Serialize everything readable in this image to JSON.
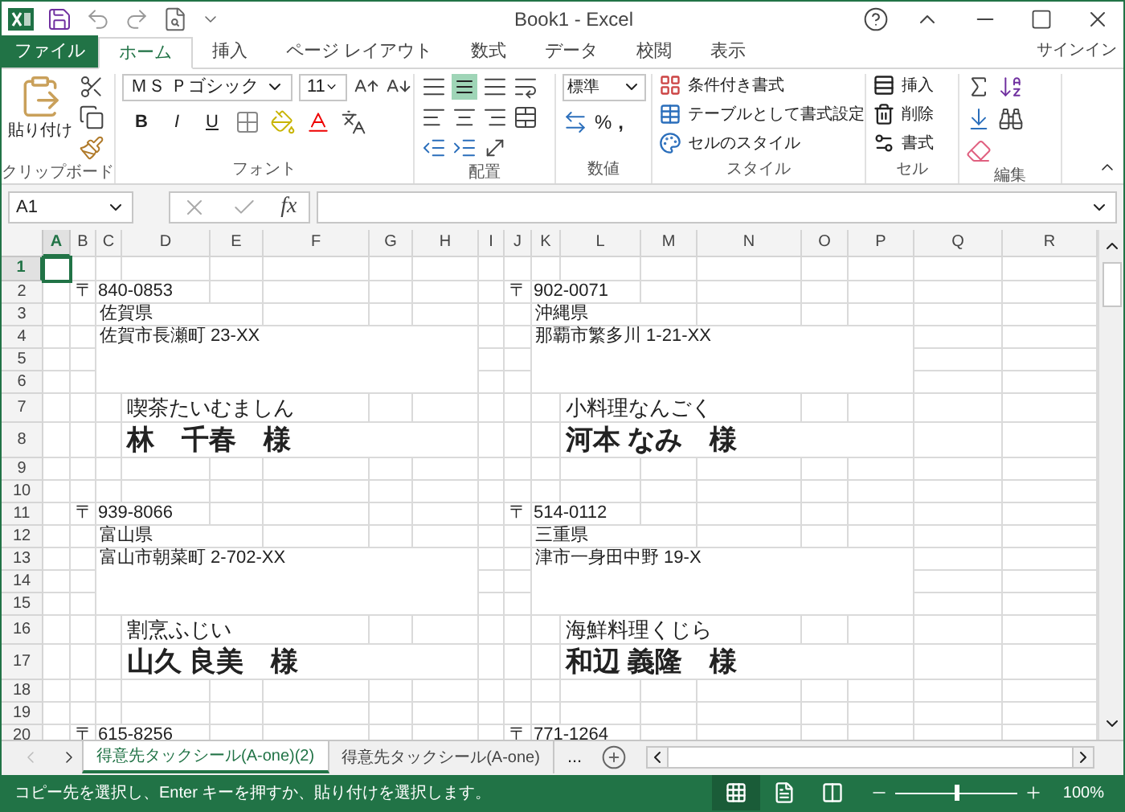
{
  "window": {
    "title": "Book1 - Excel"
  },
  "ribbon_tabs": [
    {
      "label": "ファイル",
      "kind": "file",
      "selected": false
    },
    {
      "label": "ホーム",
      "kind": "tab",
      "selected": true
    },
    {
      "label": "挿入",
      "kind": "tab",
      "selected": false
    },
    {
      "label": "ページ レイアウト",
      "kind": "tab",
      "selected": false
    },
    {
      "label": "数式",
      "kind": "tab",
      "selected": false
    },
    {
      "label": "データ",
      "kind": "tab",
      "selected": false
    },
    {
      "label": "校閲",
      "kind": "tab",
      "selected": false
    },
    {
      "label": "表示",
      "kind": "tab",
      "selected": false
    }
  ],
  "sign_in": "サインイン",
  "ribbon": {
    "clipboard": {
      "paste": "貼り付け",
      "label": "クリップボード"
    },
    "font": {
      "name": "ＭＳ Ｐゴシック",
      "size": "11",
      "format_buttons": [
        "B",
        "I",
        "U"
      ],
      "label": "フォント"
    },
    "alignment": {
      "label": "配置"
    },
    "number": {
      "format": "標準",
      "percent": "%",
      "comma": ",",
      "label": "数値"
    },
    "styles": {
      "items": [
        "条件付き書式",
        "テーブルとして書式設定",
        "セルのスタイル"
      ],
      "label": "スタイル"
    },
    "cells": {
      "items": [
        "挿入",
        "削除",
        "書式"
      ],
      "label": "セル"
    },
    "editing": {
      "label": "編集"
    }
  },
  "formula_bar": {
    "name_box": "A1",
    "function_label": "fx"
  },
  "columns": [
    {
      "label": "A",
      "selected": true
    },
    {
      "label": "B",
      "selected": false
    },
    {
      "label": "C",
      "selected": false
    },
    {
      "label": "D",
      "selected": false
    },
    {
      "label": "E",
      "selected": false
    },
    {
      "label": "F",
      "selected": false
    },
    {
      "label": "G",
      "selected": false
    },
    {
      "label": "H",
      "selected": false
    },
    {
      "label": "I",
      "selected": false
    },
    {
      "label": "J",
      "selected": false
    },
    {
      "label": "K",
      "selected": false
    },
    {
      "label": "L",
      "selected": false
    },
    {
      "label": "M",
      "selected": false
    },
    {
      "label": "N",
      "selected": false
    },
    {
      "label": "O",
      "selected": false
    },
    {
      "label": "P",
      "selected": false
    },
    {
      "label": "Q",
      "selected": false
    },
    {
      "label": "R",
      "selected": false
    }
  ],
  "rows": [
    {
      "label": "1",
      "selected": true
    },
    {
      "label": "2",
      "selected": false
    },
    {
      "label": "3",
      "selected": false
    },
    {
      "label": "4",
      "selected": false
    },
    {
      "label": "5",
      "selected": false
    },
    {
      "label": "6",
      "selected": false
    },
    {
      "label": "7",
      "selected": false
    },
    {
      "label": "8",
      "selected": false
    },
    {
      "label": "9",
      "selected": false
    },
    {
      "label": "10",
      "selected": false
    },
    {
      "label": "11",
      "selected": false
    },
    {
      "label": "12",
      "selected": false
    },
    {
      "label": "13",
      "selected": false
    },
    {
      "label": "14",
      "selected": false
    },
    {
      "label": "15",
      "selected": false
    },
    {
      "label": "16",
      "selected": false
    },
    {
      "label": "17",
      "selected": false
    },
    {
      "label": "18",
      "selected": false
    },
    {
      "label": "19",
      "selected": false
    },
    {
      "label": "20",
      "selected": false
    }
  ],
  "labels": [
    {
      "postal_mark": "〒",
      "postal": "840-0853",
      "prefecture": "佐賀県",
      "address": "佐賀市長瀬町 23-XX",
      "company": "喫茶たいむましん",
      "name": "林　千春　様"
    },
    {
      "postal_mark": "〒",
      "postal": "902-0071",
      "prefecture": "沖縄県",
      "address": "那覇市繁多川 1-21-XX",
      "company": "小料理なんごく",
      "name": "河本 なみ　様"
    },
    {
      "postal_mark": "〒",
      "postal": "939-8066",
      "prefecture": "富山県",
      "address": "富山市朝菜町 2-702-XX",
      "company": "割烹ふじい",
      "name": "山久 良美　様"
    },
    {
      "postal_mark": "〒",
      "postal": "514-0112",
      "prefecture": "三重県",
      "address": "津市一身田中野 19-X",
      "company": "海鮮料理くじら",
      "name": "和辺 義隆　様"
    },
    {
      "postal_mark": "〒",
      "postal": "615-8256"
    },
    {
      "postal_mark": "〒",
      "postal": "771-1264"
    }
  ],
  "sheet_tabs": [
    {
      "label": "得意先タックシール(A-one)(2)",
      "selected": true
    },
    {
      "label": "得意先タックシール(A-one)",
      "selected": false
    }
  ],
  "more_sheets": "...",
  "status_bar": {
    "message": "コピー先を選択し、Enter キーを押すか、貼り付けを選択します。",
    "views": [
      {
        "kind": "normal",
        "selected": true
      },
      {
        "kind": "layout",
        "selected": false
      },
      {
        "kind": "break",
        "selected": false
      }
    ],
    "zoom": {
      "level": 0.5,
      "reading": "100%"
    }
  }
}
